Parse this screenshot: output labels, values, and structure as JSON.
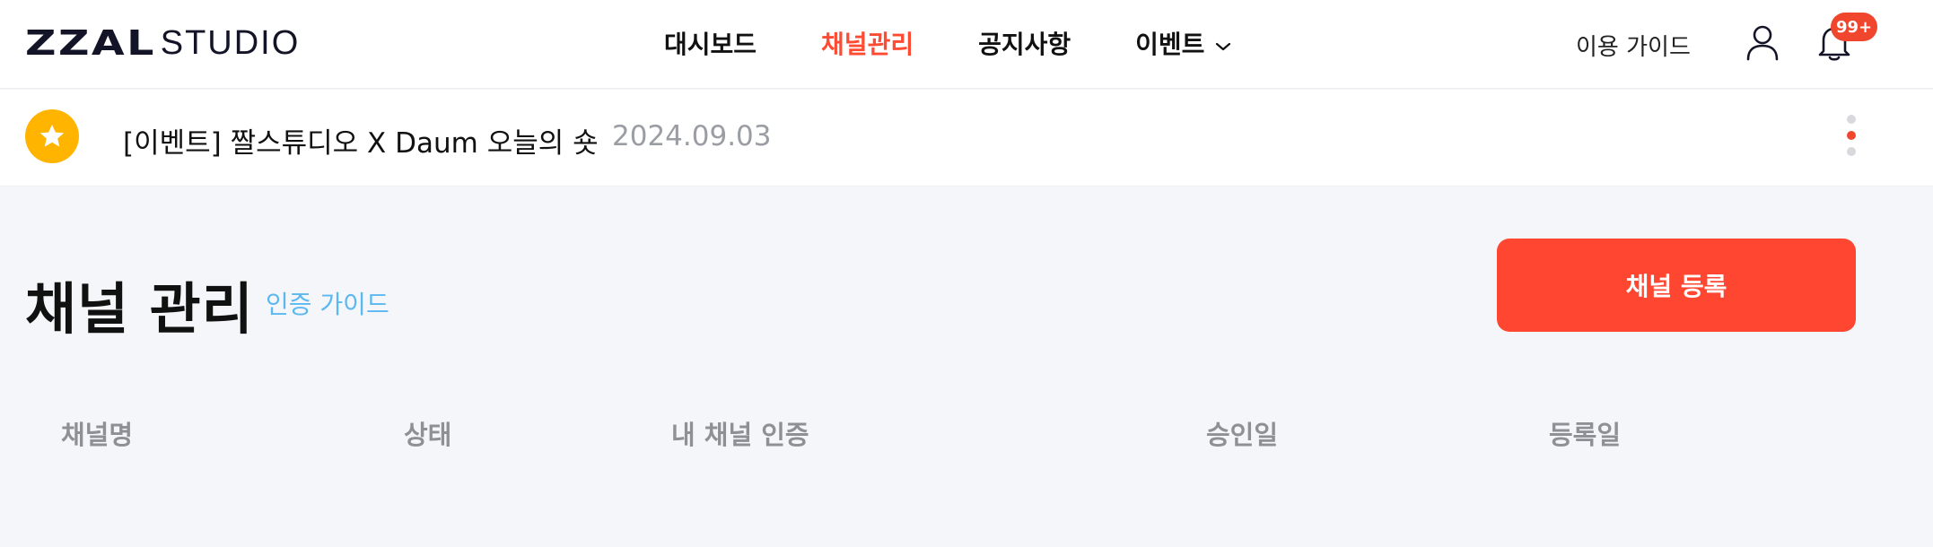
{
  "header": {
    "logo_mark": "ZZAL",
    "logo_text": "STUDIO",
    "nav": [
      {
        "label": "대시보드"
      },
      {
        "label": "채널관리"
      },
      {
        "label": "공지사항"
      },
      {
        "label": "이벤트"
      }
    ],
    "guide_link": "이용 가이드",
    "notification_badge": "99+"
  },
  "notice": {
    "title": "[이벤트] 짤스튜디오 X Daum 오늘의 숏",
    "date": "2024.09.03"
  },
  "main": {
    "page_title": "채널 관리",
    "cert_guide": "인증 가이드",
    "register_button": "채널 등록",
    "columns": [
      "채널명",
      "상태",
      "내 채널 인증",
      "승인일",
      "등록일"
    ]
  },
  "colors": {
    "accent": "#ff4630",
    "link": "#5bb8f0",
    "star": "#ffb400",
    "muted": "#8d9196",
    "background": "#f5f6f9"
  },
  "icons": {
    "user": "user-icon",
    "bell": "bell-icon",
    "star": "star-icon",
    "chevron": "chevron-down-icon"
  }
}
